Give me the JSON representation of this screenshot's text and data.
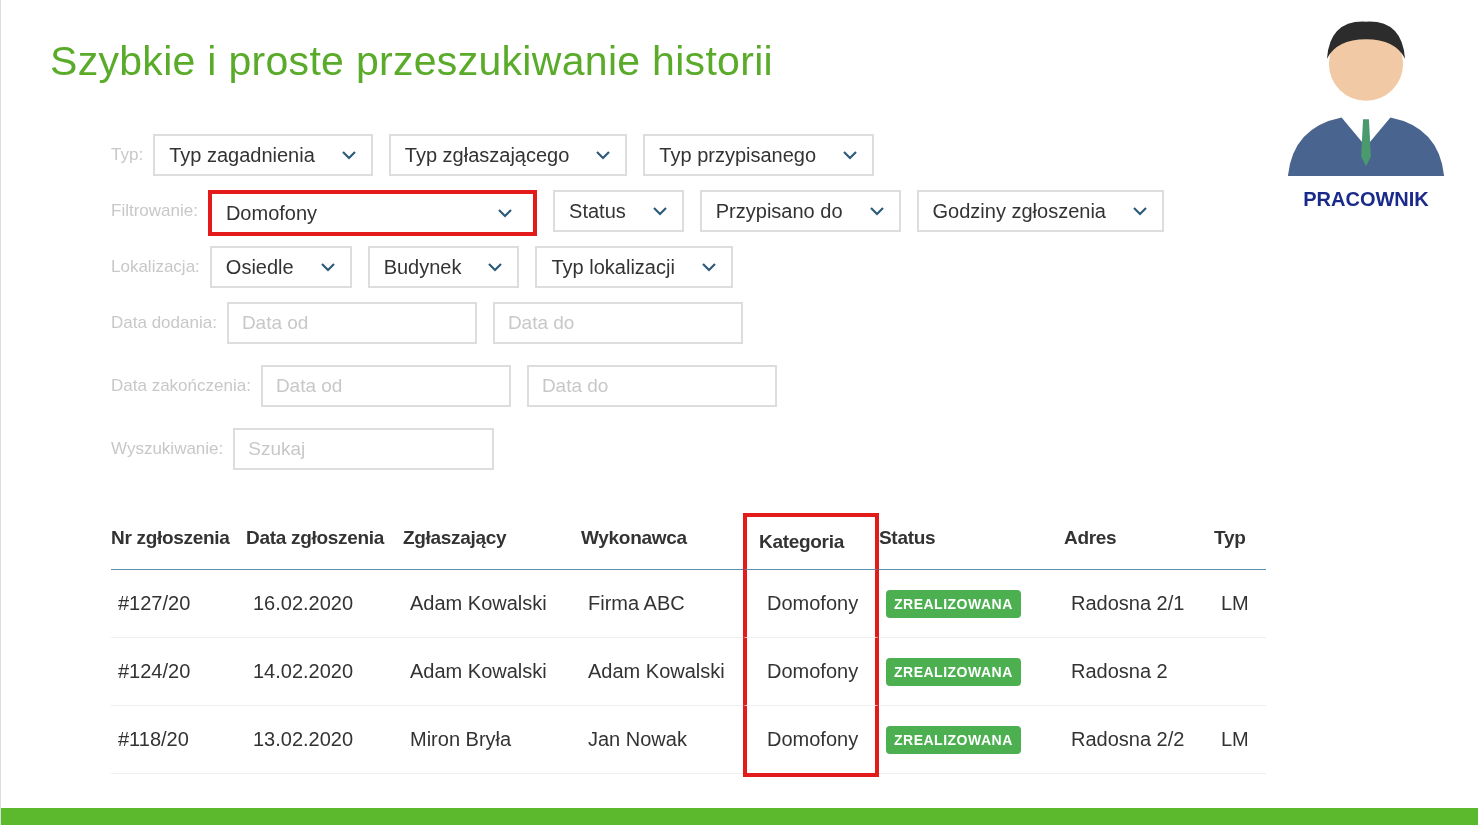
{
  "title": "Szybkie i proste przeszukiwanie historii",
  "user": {
    "label": "PRACOWNIK"
  },
  "filters": [
    {
      "label": "Typ:",
      "controls": [
        {
          "kind": "dropdown",
          "text": "Typ zagadnienia",
          "highlighted": false
        },
        {
          "kind": "dropdown",
          "text": "Typ zgłaszającego",
          "highlighted": false
        },
        {
          "kind": "dropdown",
          "text": "Typ przypisanego",
          "highlighted": false
        }
      ]
    },
    {
      "label": "Filtrowanie:",
      "controls": [
        {
          "kind": "dropdown",
          "text": "Domofony",
          "highlighted": true
        },
        {
          "kind": "dropdown",
          "text": "Status",
          "highlighted": false
        },
        {
          "kind": "dropdown",
          "text": "Przypisano do",
          "highlighted": false
        },
        {
          "kind": "dropdown",
          "text": "Godziny zgłoszenia",
          "highlighted": false
        }
      ]
    },
    {
      "label": "Lokalizacja:",
      "controls": [
        {
          "kind": "dropdown",
          "text": "Osiedle",
          "highlighted": false
        },
        {
          "kind": "dropdown",
          "text": "Budynek",
          "highlighted": false
        },
        {
          "kind": "dropdown",
          "text": "Typ lokalizacji",
          "highlighted": false
        }
      ]
    },
    {
      "label": "Data dodania:",
      "controls": [
        {
          "kind": "input",
          "placeholder": "Data od",
          "highlighted": false
        },
        {
          "kind": "input",
          "placeholder": "Data do",
          "highlighted": false
        }
      ]
    },
    {
      "label": "Data zakończenia:",
      "controls": [
        {
          "kind": "input",
          "placeholder": "Data od",
          "highlighted": false
        },
        {
          "kind": "input",
          "placeholder": "Data do",
          "highlighted": false
        }
      ]
    },
    {
      "label": "Wyszukiwanie:",
      "controls": [
        {
          "kind": "input",
          "placeholder": "Szukaj",
          "highlighted": false
        }
      ]
    }
  ],
  "table": {
    "columns": [
      {
        "label": "Nr zgłoszenia",
        "highlighted": false
      },
      {
        "label": "Data zgłoszenia",
        "highlighted": false
      },
      {
        "label": "Zgłaszający",
        "highlighted": false
      },
      {
        "label": "Wykonawca",
        "highlighted": false
      },
      {
        "label": "Kategoria",
        "highlighted": true
      },
      {
        "label": "Status",
        "highlighted": false
      },
      {
        "label": "Adres",
        "highlighted": false
      },
      {
        "label": "Typ",
        "highlighted": false
      }
    ],
    "rows": [
      {
        "cells": [
          "#127/20",
          "16.02.2020",
          "Adam Kowalski",
          "Firma ABC",
          "Domofony",
          "ZREALIZOWANA",
          "Radosna 2/1",
          "LM"
        ]
      },
      {
        "cells": [
          "#124/20",
          "14.02.2020",
          "Adam Kowalski",
          "Adam Kowalski",
          "Domofony",
          "ZREALIZOWANA",
          "Radosna 2",
          ""
        ]
      },
      {
        "cells": [
          "#118/20",
          "13.02.2020",
          "Miron Bryła",
          "Jan Nowak",
          "Domofony",
          "ZREALIZOWANA",
          "Radosna 2/2",
          "LM"
        ]
      }
    ]
  }
}
